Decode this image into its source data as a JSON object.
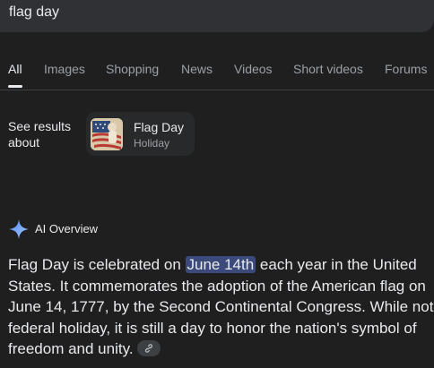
{
  "search": {
    "query": "flag day"
  },
  "tabs": [
    {
      "label": "All",
      "active": true
    },
    {
      "label": "Images"
    },
    {
      "label": "Shopping"
    },
    {
      "label": "News"
    },
    {
      "label": "Videos"
    },
    {
      "label": "Short videos"
    },
    {
      "label": "Forums"
    }
  ],
  "see_results": {
    "label": "See results about",
    "entity": {
      "title": "Flag Day",
      "subtitle": "Holiday",
      "thumbnail_icon": "flag-thumbnail"
    }
  },
  "ai_overview": {
    "label": "AI Overview",
    "icon": "sparkle-icon",
    "text_before": "Flag Day is celebrated on ",
    "highlight": "June 14th",
    "text_after": " each year in the United States. It commemorates the adoption of the American flag on June 14, 1777, by the Second Continental Congress. While not a federal holiday, it is still a day to honor the nation's symbol of freedom and unity.",
    "link_icon": "link-icon"
  },
  "colors": {
    "background": "#1f1f1f",
    "search_bar": "#303134",
    "text": "#e8eaed",
    "muted": "#9aa0a6",
    "highlight": "#3b4a7a",
    "sparkle": "#8ab4f8"
  }
}
